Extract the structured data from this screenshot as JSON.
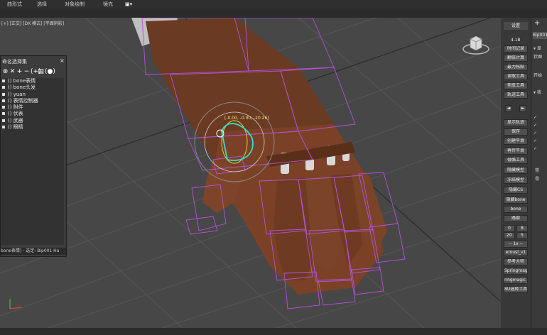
{
  "menu": {
    "items": [
      "曲形式",
      "选择",
      "对象绘制",
      "镜充"
    ]
  },
  "viewport": {
    "label": "[+] [正交] [DX 模式] [平面阴影]",
    "coord_readout": "[-0.00, -0.00, -20.26]"
  },
  "named_selection": {
    "title": "命名选择集",
    "close_glyph": "×",
    "toolbar": [
      "⊛",
      "✕",
      "+",
      "−",
      "(+)",
      "▤",
      "(●)"
    ],
    "items": [
      "() bone表情",
      "() bone头发",
      "() yuan",
      "() 表情控制器",
      "() 附件",
      "() 伏表",
      "() 武器",
      "() 眼睛"
    ],
    "status": "bone表情] - 选定: Bip001 Ha"
  },
  "script_panel": {
    "header": "设置",
    "version": "4.18",
    "buttons": [
      "时间记录",
      "翻倍计算",
      "最力帖贴",
      "读取工具",
      "塑皮工具",
      "轨迹工具",
      "显示轨迹",
      "保存",
      "创建平滑",
      "再传平滑",
      "骨骼工具",
      "隐藏模型",
      "冻结模型",
      "隐藏CS",
      "隐藏bone",
      "bone",
      "路部"
    ],
    "arrow_left": "◄",
    "arrow_right": "►",
    "field_left_1": "0",
    "field_right_1": "8",
    "field_left_2": "20",
    "field_right_2": "5",
    "dropdown": "-- 1x --",
    "lower_buttons": [
      "erousl_v1",
      "参考大师",
      "Springmag",
      "ringmagic_",
      "8U选择工具"
    ]
  },
  "command_panel": {
    "plus": "+",
    "tab": "Bip001",
    "texts": [
      "▾ 显",
      "状图",
      "开始",
      "▾ 我",
      "✓",
      "✓",
      "✓",
      "✓",
      "✓",
      "常",
      "骨"
    ]
  },
  "colors": {
    "wireframe": "#b552d8",
    "gizmo": "#33e0cf",
    "glove": "#6e3a22",
    "background": "#474747"
  }
}
